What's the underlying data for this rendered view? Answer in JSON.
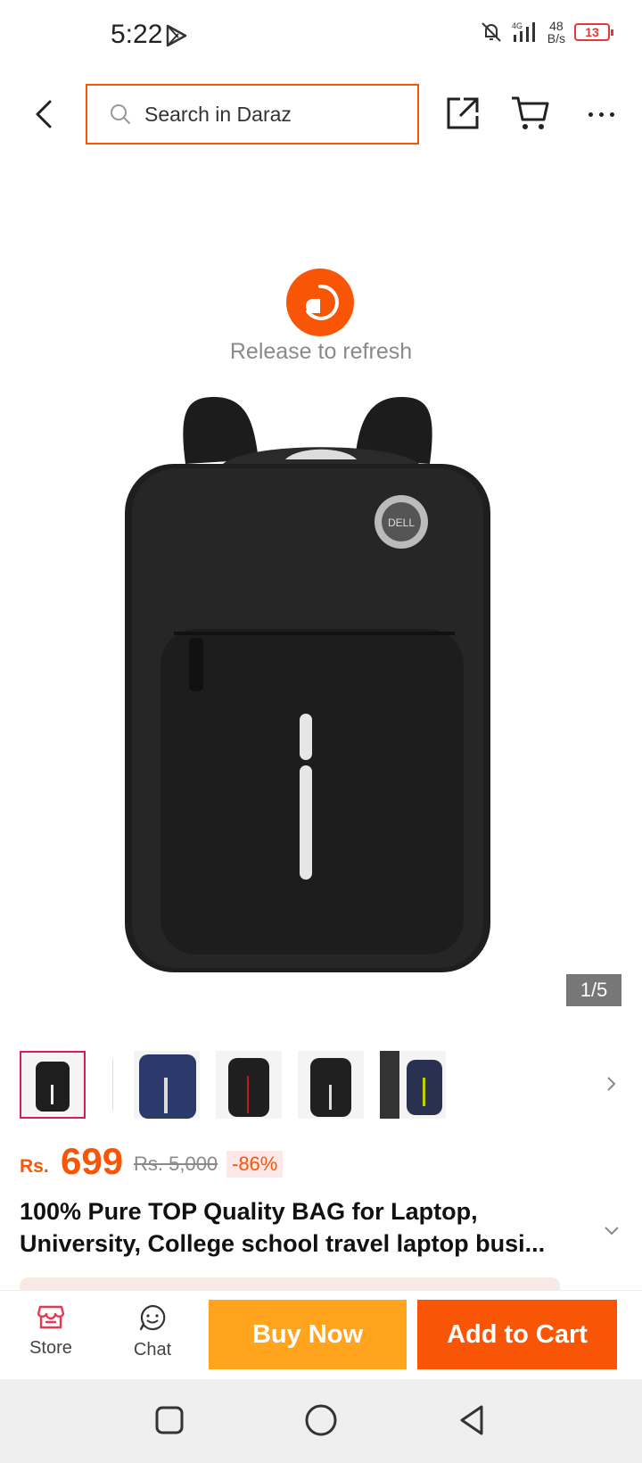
{
  "status": {
    "time": "5:22",
    "net_speed_top": "48",
    "net_speed_bottom": "B/s",
    "network": "4G",
    "battery": "13"
  },
  "header": {
    "search_placeholder": "Search in Daraz"
  },
  "refresh": {
    "text": "Release to refresh"
  },
  "gallery": {
    "counter": "1/5",
    "thumbnail_count": 5
  },
  "price": {
    "currency": "Rs.",
    "current": "699",
    "original": "Rs. 5,000",
    "discount": "-86%"
  },
  "product": {
    "title_line1": "100% Pure TOP Quality BAG for Laptop,",
    "title_line2": "University, College school travel laptop busi..."
  },
  "bottom_bar": {
    "store_label": "Store",
    "chat_label": "Chat",
    "buy_now_label": "Buy Now",
    "add_to_cart_label": "Add to Cart"
  },
  "colors": {
    "brand": "#f85606",
    "buy_now": "#ffa41c",
    "active_thumb": "#d81b60"
  }
}
